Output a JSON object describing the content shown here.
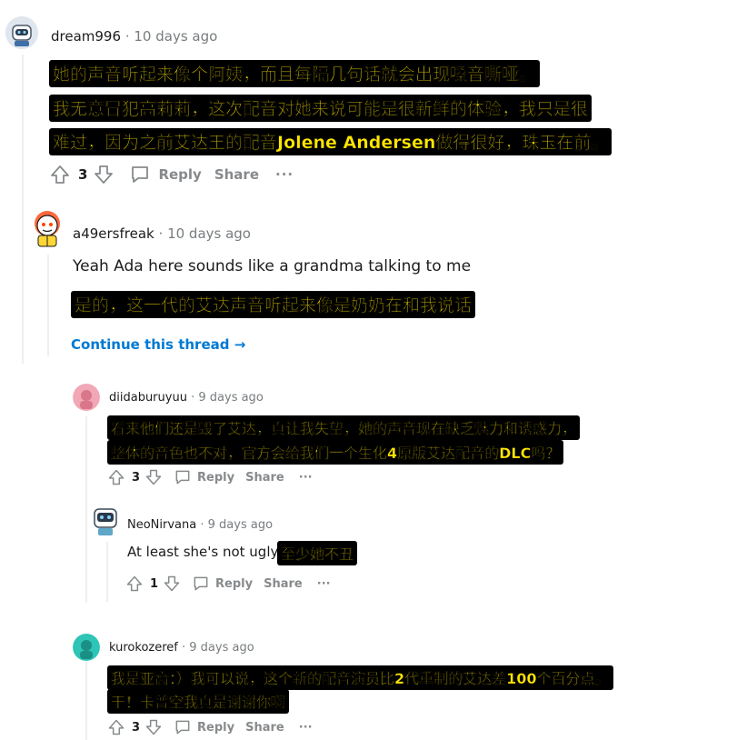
{
  "comments": [
    {
      "username": "dream996",
      "separator": "·",
      "time": "10 days ago",
      "subtitle_lines": [
        "她的声音听起来像个阿姨，而且每隔几句话就会出现嗓音嘶哑。",
        "我无意冒犯高莉莉，这次配音对她来说可能是很新鲜的体验，我只是很",
        "难过，因为之前艾达王的配音Jolene Andersen做得很好，珠玉在前。"
      ],
      "votes": "3",
      "reply_label": "Reply",
      "share_label": "Share",
      "more_label": "···"
    },
    {
      "username": "a49ersfreak",
      "separator": "·",
      "time": "10 days ago",
      "text": "Yeah Ada here sounds like a grandma talking to me",
      "subtitle_lines": [
        "是的，这一代的艾达声音听起来像是奶奶在和我说话"
      ],
      "continue_label": "Continue this thread →"
    },
    {
      "username": "diidaburuyuu",
      "separator": "·",
      "time": "9 days ago",
      "subtitle_lines": [
        "看来他们还是毁了艾达，真让我失望，她的声音现在缺乏魅力和诱惑力，",
        "整体的音色也不对，官方会给我们一个生化4原版艾达配音的DLC吗？"
      ],
      "votes": "3",
      "reply_label": "Reply",
      "share_label": "Share",
      "more_label": "···"
    },
    {
      "username": "NeoNirvana",
      "separator": "·",
      "time": "9 days ago",
      "text": "At least she's not ugly.",
      "subtitle_lines": [
        "至少她不丑"
      ],
      "votes": "1",
      "reply_label": "Reply",
      "share_label": "Share",
      "more_label": "···"
    },
    {
      "username": "kurokozeref",
      "separator": "·",
      "time": "9 days ago",
      "subtitle_lines": [
        "我是亚裔：）我可以说，这个新的配音演员比2代重制的艾达差100个百分点。",
        "干！卡普空我真是谢谢你啊"
      ],
      "votes": "3",
      "reply_label": "Reply",
      "share_label": "Share",
      "more_label": "···"
    }
  ],
  "colors": {
    "meta_gray": "#787c7e",
    "action_gray": "#878a8c",
    "link_blue": "#0079d3",
    "subtitle_yellow": "#ffe600",
    "thread_line": "#edeff1"
  },
  "icons": [
    "upvote-icon",
    "downvote-icon",
    "comment-reply-icon",
    "more-icon",
    "avatar"
  ]
}
